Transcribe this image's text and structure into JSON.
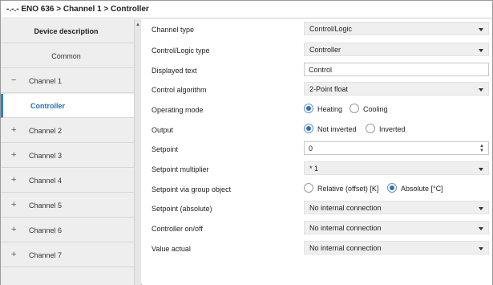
{
  "window": {
    "title": "-.-.- ENO 636 > Channel 1 > Controller"
  },
  "sidebar": {
    "items": [
      {
        "label": "Device description",
        "sign": "",
        "bold": true,
        "selected": false
      },
      {
        "label": "Common",
        "sign": "",
        "bold": false,
        "selected": false
      },
      {
        "label": "Channel 1",
        "sign": "−",
        "bold": false,
        "selected": false
      },
      {
        "label": "Controller",
        "sign": "",
        "bold": false,
        "selected": true
      },
      {
        "label": "Channel 2",
        "sign": "+",
        "bold": false,
        "selected": false
      },
      {
        "label": "Channel 3",
        "sign": "+",
        "bold": false,
        "selected": false
      },
      {
        "label": "Channel 4",
        "sign": "+",
        "bold": false,
        "selected": false
      },
      {
        "label": "Channel 5",
        "sign": "+",
        "bold": false,
        "selected": false
      },
      {
        "label": "Channel 6",
        "sign": "+",
        "bold": false,
        "selected": false
      },
      {
        "label": "Channel 7",
        "sign": "+",
        "bold": false,
        "selected": false
      }
    ]
  },
  "scrollbar": {
    "up_arrow": "▲"
  },
  "params": {
    "rows": [
      {
        "label": "Channel type",
        "type": "select",
        "value": "Control/Logic"
      },
      {
        "label": "Control/Logic type",
        "type": "select",
        "value": "Controller"
      },
      {
        "label": "Displayed text",
        "type": "text",
        "value": "Control"
      },
      {
        "label": "Control algorithm",
        "type": "select",
        "value": "2-Point float"
      },
      {
        "label": "Operating mode",
        "type": "radio",
        "options": [
          {
            "label": "Heating",
            "selected": true
          },
          {
            "label": "Cooling",
            "selected": false
          }
        ]
      },
      {
        "label": "Output",
        "type": "radio",
        "options": [
          {
            "label": "Not inverted",
            "selected": true
          },
          {
            "label": "Inverted",
            "selected": false
          }
        ]
      },
      {
        "label": "Setpoint",
        "type": "spinner",
        "value": "0",
        "up": "▲",
        "down": "▼"
      },
      {
        "label": "Setpoint multiplier",
        "type": "select",
        "value": "* 1"
      },
      {
        "label": "Setpoint via group object",
        "type": "radio",
        "options": [
          {
            "label": "Relative (offset) [K]",
            "selected": false
          },
          {
            "label": "Absolute [°C]",
            "selected": true
          }
        ]
      },
      {
        "label": "Setpoint (absolute)",
        "type": "select",
        "value": "No internal connection"
      },
      {
        "label": "Controller on/off",
        "type": "select",
        "value": "No internal connection"
      },
      {
        "label": "Value actual",
        "type": "select",
        "value": "No internal connection"
      }
    ]
  },
  "colors": {
    "accent": "#2e7fd0",
    "sidebar_bg": "#eeeeee",
    "select_bg": "#efefef"
  }
}
